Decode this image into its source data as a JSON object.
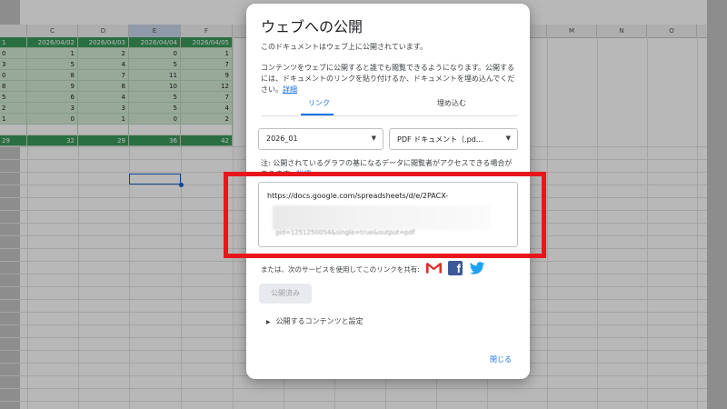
{
  "sheet": {
    "columns": [
      {
        "label": "C",
        "selected": false
      },
      {
        "label": "D",
        "selected": false
      },
      {
        "label": "E",
        "selected": true
      },
      {
        "label": "F",
        "selected": false
      }
    ],
    "right_columns": [
      "M",
      "N",
      "O"
    ],
    "rows": [
      {
        "type": "header",
        "cells": [
          "1",
          "2026/04/02",
          "2026/04/03",
          "2026/04/04",
          "2026/04/05"
        ]
      },
      {
        "type": "data",
        "cells": [
          "0",
          "1",
          "2",
          "0",
          "1"
        ]
      },
      {
        "type": "data",
        "cells": [
          "3",
          "5",
          "4",
          "5",
          "7"
        ]
      },
      {
        "type": "data",
        "cells": [
          "0",
          "8",
          "7",
          "11",
          "9"
        ]
      },
      {
        "type": "data",
        "cells": [
          "8",
          "9",
          "8",
          "10",
          "12"
        ]
      },
      {
        "type": "data",
        "cells": [
          "5",
          "6",
          "4",
          "5",
          "7"
        ]
      },
      {
        "type": "data",
        "cells": [
          "2",
          "3",
          "3",
          "5",
          "4"
        ]
      },
      {
        "type": "data",
        "cells": [
          "1",
          "0",
          "1",
          "0",
          "2"
        ]
      },
      {
        "type": "blank",
        "cells": [
          "",
          "",
          "",
          "",
          ""
        ]
      },
      {
        "type": "total",
        "cells": [
          "29",
          "32",
          "29",
          "36",
          "42"
        ]
      }
    ]
  },
  "dialog": {
    "title": "ウェブへの公開",
    "status": "このドキュメントはウェブ上に公開されています。",
    "description": "コンテンツをウェブに公開すると誰でも閲覧できるようになります。公開するには、ドキュメントのリンクを貼り付けるか、ドキュメントを埋め込んでください。",
    "detail_link": "詳細",
    "tabs": [
      {
        "label": "リンク",
        "active": true
      },
      {
        "label": "埋め込む",
        "active": false
      }
    ],
    "sheet_select": "2026_01",
    "format_select": "PDF ドキュメント（.pd...",
    "note": "注: 公開されているグラフの基になるデータに閲覧者がアクセスできる場合があります。",
    "note_link": "詳細",
    "url_line1": "https://docs.google.com/spreadsheets/d/e/2PACX-",
    "url_line3": "gid=1251250054&single=true&output=pdf",
    "share_text": "または、次のサービスを使用してこのリンクを共有:",
    "publish_button": "公開済み",
    "settings_toggle": "公開するコンテンツと設定",
    "close_button": "閉じる",
    "icons": [
      "gmail-icon",
      "facebook-icon",
      "twitter-icon",
      "dropdown-arrow-icon",
      "expand-arrow-icon"
    ]
  },
  "colors": {
    "accent": "#1a73e8",
    "highlight": "#e8161c",
    "sheet_green": "#3a9a5a",
    "sheet_light_green": "#d3ead5"
  }
}
